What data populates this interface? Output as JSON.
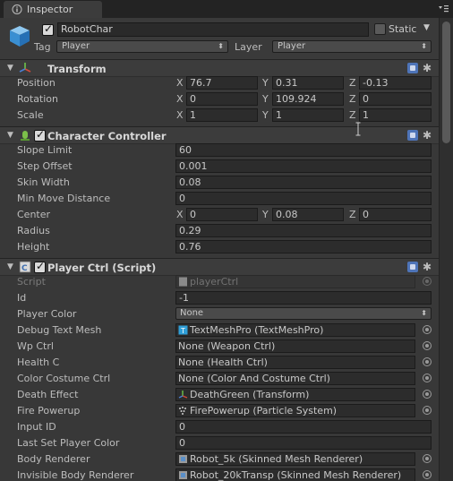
{
  "window": {
    "tab_title": "Inspector",
    "tab_icon": "info-icon",
    "menu_icon": "tab-menu-icon"
  },
  "object": {
    "active": true,
    "name": "RobotChar",
    "static_label": "Static",
    "static": false,
    "tag_label": "Tag",
    "tag_value": "Player",
    "layer_label": "Layer",
    "layer_value": "Player"
  },
  "transform": {
    "title": "Transform",
    "position_label": "Position",
    "rotation_label": "Rotation",
    "scale_label": "Scale",
    "axes": [
      "X",
      "Y",
      "Z"
    ],
    "position": [
      "76.7",
      "0.31",
      "-0.13"
    ],
    "rotation": [
      "0",
      "109.924",
      "0"
    ],
    "scale": [
      "1",
      "1",
      "1"
    ]
  },
  "character_controller": {
    "title": "Character Controller",
    "enabled": true,
    "rows": [
      {
        "label": "Slope Limit",
        "value": "60"
      },
      {
        "label": "Step Offset",
        "value": "0.001"
      },
      {
        "label": "Skin Width",
        "value": "0.08"
      },
      {
        "label": "Min Move Distance",
        "value": "0"
      }
    ],
    "center_label": "Center",
    "center": [
      "0",
      "0.08",
      "0"
    ],
    "radius_label": "Radius",
    "radius": "0.29",
    "height_label": "Height",
    "height": "0.76"
  },
  "player_ctrl": {
    "title": "Player Ctrl (Script)",
    "enabled": true,
    "script_label": "Script",
    "script_value": "playerCtrl",
    "id_label": "Id",
    "id_value": "-1",
    "player_color_label": "Player Color",
    "player_color_value": "None",
    "refs": [
      {
        "label": "Debug Text Mesh",
        "value": "TextMeshPro (TextMeshPro)",
        "icon": "textmeshpro-icon"
      },
      {
        "label": "Wp Ctrl",
        "value": "None (Weapon Ctrl)",
        "icon": ""
      },
      {
        "label": "Health C",
        "value": "None (Health Ctrl)",
        "icon": ""
      },
      {
        "label": "Color Costume Ctrl",
        "value": "None (Color And Costume Ctrl)",
        "icon": ""
      },
      {
        "label": "Death Effect",
        "value": "DeathGreen (Transform)",
        "icon": "transform-icon"
      },
      {
        "label": "Fire Powerup",
        "value": "FirePowerup (Particle System)",
        "icon": "particle-system-icon"
      }
    ],
    "input_id_label": "Input ID",
    "input_id_value": "0",
    "last_color_label": "Last Set Player Color",
    "last_color_value": "0",
    "body_renderer_label": "Body Renderer",
    "body_renderer_value": "Robot_5k (Skinned Mesh Renderer)",
    "invisible_renderer_label": "Invisible Body Renderer",
    "invisible_renderer_value": "Robot_20kTransp (Skinned Mesh Renderer)"
  },
  "colors": {
    "panel": "#383838",
    "field": "#2c2c2c",
    "help_blue": "#4e74b8"
  }
}
